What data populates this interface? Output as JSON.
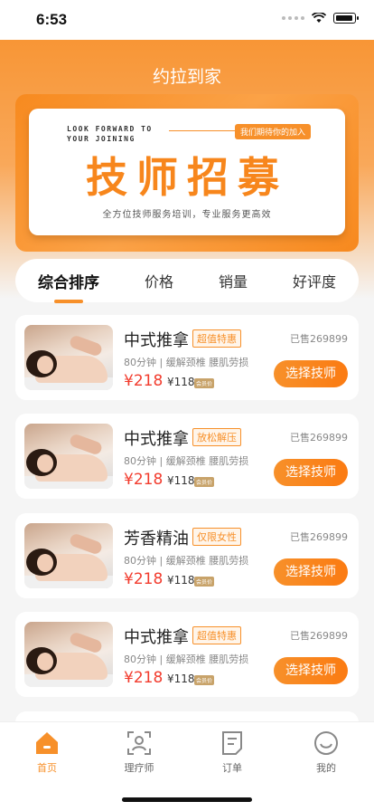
{
  "status_bar": {
    "time": "6:53"
  },
  "app_title": "约拉到家",
  "banner": {
    "english": "LOOK FORWARD TO YOUR JOINING",
    "pill": "我们期待你的加入",
    "headline": "技师招募",
    "subtitle": "全方位技师服务培训，专业服务更高效"
  },
  "sort_tabs": [
    {
      "label": "综合排序",
      "active": true
    },
    {
      "label": "价格",
      "active": false
    },
    {
      "label": "销量",
      "active": false
    },
    {
      "label": "好评度",
      "active": false
    }
  ],
  "services": [
    {
      "title": "中式推拿",
      "tag": "超值特惠",
      "sold": "已售269899",
      "desc": "80分钟 | 缓解颈椎 腰肌劳损",
      "price": "¥218",
      "orig": "¥118",
      "badge": "会员价",
      "button": "选择技师"
    },
    {
      "title": "中式推拿",
      "tag": "放松解压",
      "sold": "已售269899",
      "desc": "80分钟 | 缓解颈椎 腰肌劳损",
      "price": "¥218",
      "orig": "¥118",
      "badge": "会员价",
      "button": "选择技师"
    },
    {
      "title": "芳香精油",
      "tag": "仅限女性",
      "sold": "已售269899",
      "desc": "80分钟 | 缓解颈椎 腰肌劳损",
      "price": "¥218",
      "orig": "¥118",
      "badge": "会员价",
      "button": "选择技师"
    },
    {
      "title": "中式推拿",
      "tag": "超值特惠",
      "sold": "已售269899",
      "desc": "80分钟 | 缓解颈椎 腰肌劳损",
      "price": "¥218",
      "orig": "¥118",
      "badge": "会员价",
      "button": "选择技师"
    }
  ],
  "tabbar": [
    {
      "label": "首页",
      "icon": "home-icon",
      "active": true
    },
    {
      "label": "理疗师",
      "icon": "therapist-icon",
      "active": false
    },
    {
      "label": "订单",
      "icon": "order-icon",
      "active": false
    },
    {
      "label": "我的",
      "icon": "profile-icon",
      "active": false
    }
  ],
  "colors": {
    "accent": "#f7902a",
    "price": "#f23c2e"
  }
}
